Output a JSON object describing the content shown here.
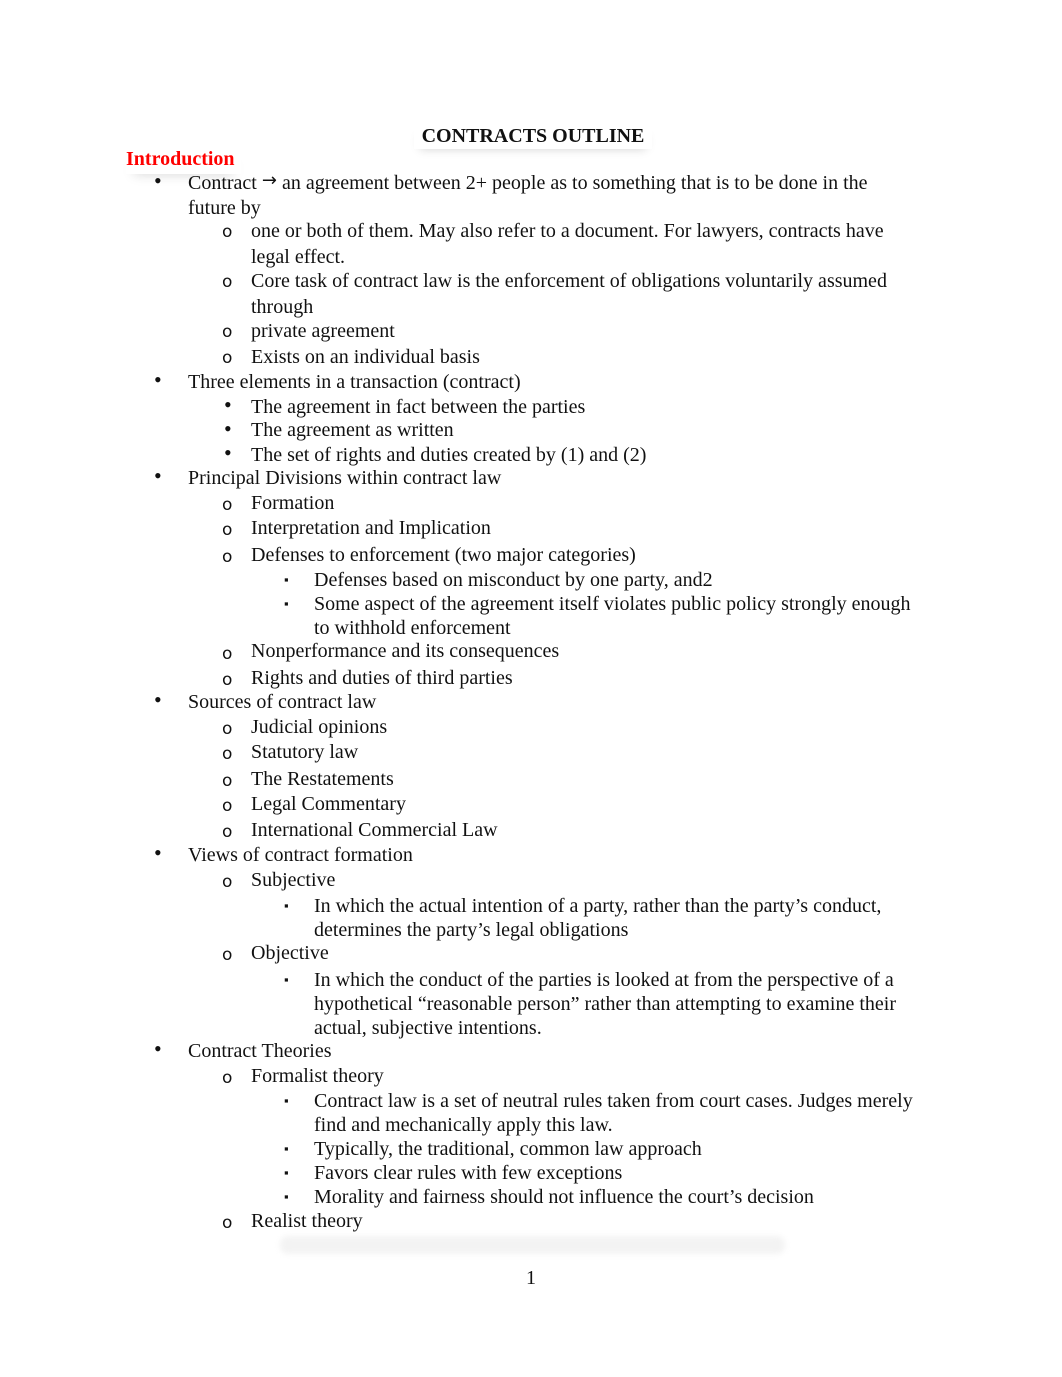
{
  "document": {
    "title": "CONTRACTS OUTLINE",
    "section_heading": "Introduction",
    "section_heading_color": "#ff0000",
    "page_number": "1",
    "lines": {
      "l0a": "Contract",
      "l0b": "an agreement between 2+ people as to something that is to be done in the",
      "l0c": "future by",
      "l1": "one or both of them. May also refer to a document. For lawyers, contracts have",
      "l1b": "legal effect.",
      "l2": "Core task of contract law is the enforcement of obligations voluntarily assumed",
      "l2b": "through",
      "l3": "private agreement",
      "l4": "Exists on an individual basis",
      "l5": "Three elements in a transaction (contract)",
      "l6": "The agreement in fact between the parties",
      "l7": "The agreement as written",
      "l8": "The set of rights and duties created by (1) and (2)",
      "l9": "Principal Divisions within contract law",
      "l10": "Formation",
      "l11": "Interpretation and Implication",
      "l12": "Defenses to enforcement (two major categories)",
      "l13": "Defenses based on misconduct by one party, and2",
      "l14": "Some aspect of the agreement itself violates public policy strongly enough",
      "l14b": "to withhold enforcement",
      "l15": "Nonperformance and its consequences",
      "l16": "Rights and duties of third parties",
      "l17": "Sources of contract law",
      "l18": "Judicial opinions",
      "l19": "Statutory law",
      "l20": "The Restatements",
      "l21": "Legal Commentary",
      "l22": "International Commercial Law",
      "l23": "Views of contract formation",
      "l24": "Subjective",
      "l25": "In which the actual intention of a party, rather than the party’s conduct,",
      "l25b": "determines the party’s legal obligations",
      "l26": "Objective",
      "l27": "In which the conduct of the parties is looked at from the perspective of a",
      "l27b": "hypothetical “reasonable person” rather than attempting to examine their",
      "l27c": "actual, subjective intentions.",
      "l28": "Contract Theories",
      "l29": "Formalist theory",
      "l30": "Contract law is a set of neutral rules taken from court cases. Judges merely",
      "l30b": "find and mechanically apply this law.",
      "l31": "Typically, the traditional, common law approach",
      "l32": "Favors clear rules with few exceptions",
      "l33": "Morality and fairness should not influence the court’s decision",
      "l34": "Realist theory"
    },
    "glyphs": {
      "bullet": "•",
      "circle": "o",
      "square": "▪",
      "arrow": "→"
    }
  }
}
